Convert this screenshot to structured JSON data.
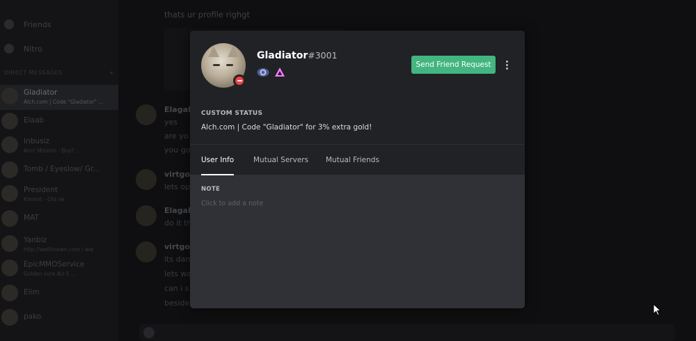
{
  "background": {
    "nav": [
      {
        "label": "Friends",
        "icon": "friends-icon"
      },
      {
        "label": "Nitro",
        "icon": "nitro-icon"
      }
    ],
    "dm_header": "DIRECT MESSAGES",
    "dm_add_icon": "plus-icon",
    "dms": [
      {
        "name": "Gladiator",
        "sub": "Alch.com | Code \"Gladiator\" ...",
        "active": true
      },
      {
        "name": "Elaab",
        "sub": ""
      },
      {
        "name": "Inbusiz",
        "sub": "Ans! Mission - Buy? .."
      },
      {
        "name": "Tomb / Eyeslow/ Gr...",
        "sub": ""
      },
      {
        "name": "President",
        "sub": "Kimmit - Old ve"
      },
      {
        "name": "MAT",
        "sub": ""
      },
      {
        "name": "Yanbiz",
        "sub": "http://wellknown.com / ww"
      },
      {
        "name": "EpicMMOService",
        "sub": "Golden sure AU 5 ..."
      },
      {
        "name": "Elim",
        "sub": ""
      },
      {
        "name": "pako",
        "sub": ""
      }
    ],
    "chat_top": "thats ur profile righgt",
    "messages": [
      {
        "author": "Elagab",
        "lines": [
          "yes",
          "are yo",
          "you go"
        ]
      },
      {
        "author": "virtgol",
        "lines": [
          "lets op"
        ]
      },
      {
        "author": "Elagab",
        "lines": [
          "do it th"
        ]
      },
      {
        "author": "virtgol",
        "lines": [
          "its dan",
          "lets wa",
          "can i s",
          "beside"
        ]
      }
    ]
  },
  "profile": {
    "username": "Gladiator",
    "discriminator": "#3001",
    "status_color": "#ed4245",
    "badges": [
      {
        "icon": "hypesquad-balance-icon",
        "color": "#7289da"
      },
      {
        "icon": "hypesquad-triangle-icon",
        "color": "#f47fff"
      }
    ],
    "friend_button": "Send Friend Request",
    "friend_button_color": "#43b581",
    "more_icon": "more-vertical-icon",
    "custom_status_label": "CUSTOM STATUS",
    "custom_status": "Alch.com | Code \"Gladiator\" for 3% extra gold!",
    "tabs": [
      {
        "label": "User Info",
        "active": true
      },
      {
        "label": "Mutual Servers",
        "active": false
      },
      {
        "label": "Mutual Friends",
        "active": false
      }
    ],
    "note_label": "NOTE",
    "note_placeholder": "Click to add a note",
    "note_value": ""
  }
}
